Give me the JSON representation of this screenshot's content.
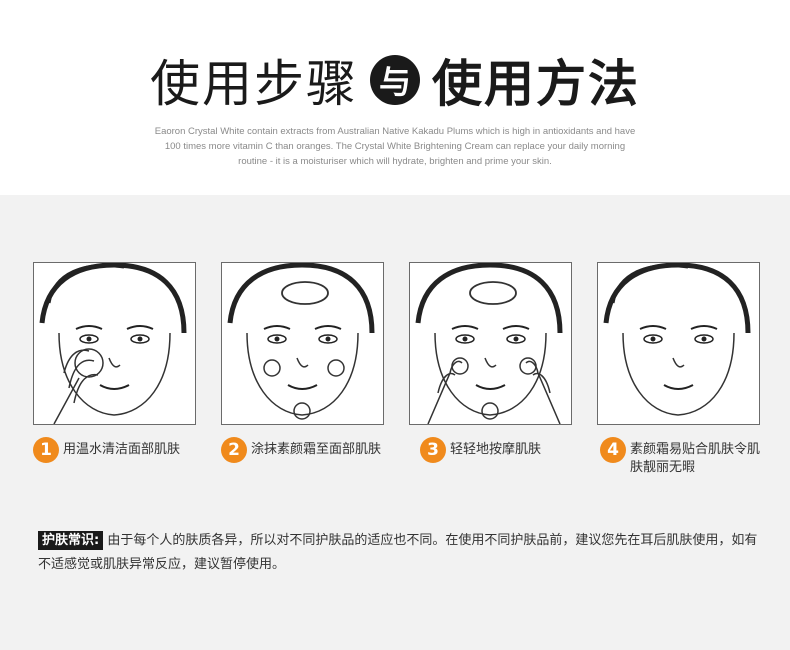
{
  "header": {
    "title_light": "使用步骤",
    "badge": "与",
    "title_bold": "使用方法",
    "intro": "Eaoron Crystal White contain extracts from Australian Native Kakadu Plums which is high in antioxidants and have 100 times more vitamin C than oranges. The Crystal White Brightening Cream can replace your daily morning routine - it is a moisturiser which will hydrate, brighten and prime your skin."
  },
  "steps": [
    {
      "num": "1",
      "text": "用温水清洁面部肌肤"
    },
    {
      "num": "2",
      "text": "涂抹素颜霜至面部肌肤"
    },
    {
      "num": "3",
      "text": "轻轻地按摩肌肤"
    },
    {
      "num": "4",
      "text": "素颜霜易贴合肌肤令肌肤靓丽无暇"
    }
  ],
  "note": {
    "tag": "护肤常识:",
    "text": "由于每个人的肤质各异，所以对不同护肤品的适应也不同。在使用不同护肤品前，建议您先在耳后肌肤使用，如有不适感觉或肌肤异常反应，建议暂停使用。"
  }
}
